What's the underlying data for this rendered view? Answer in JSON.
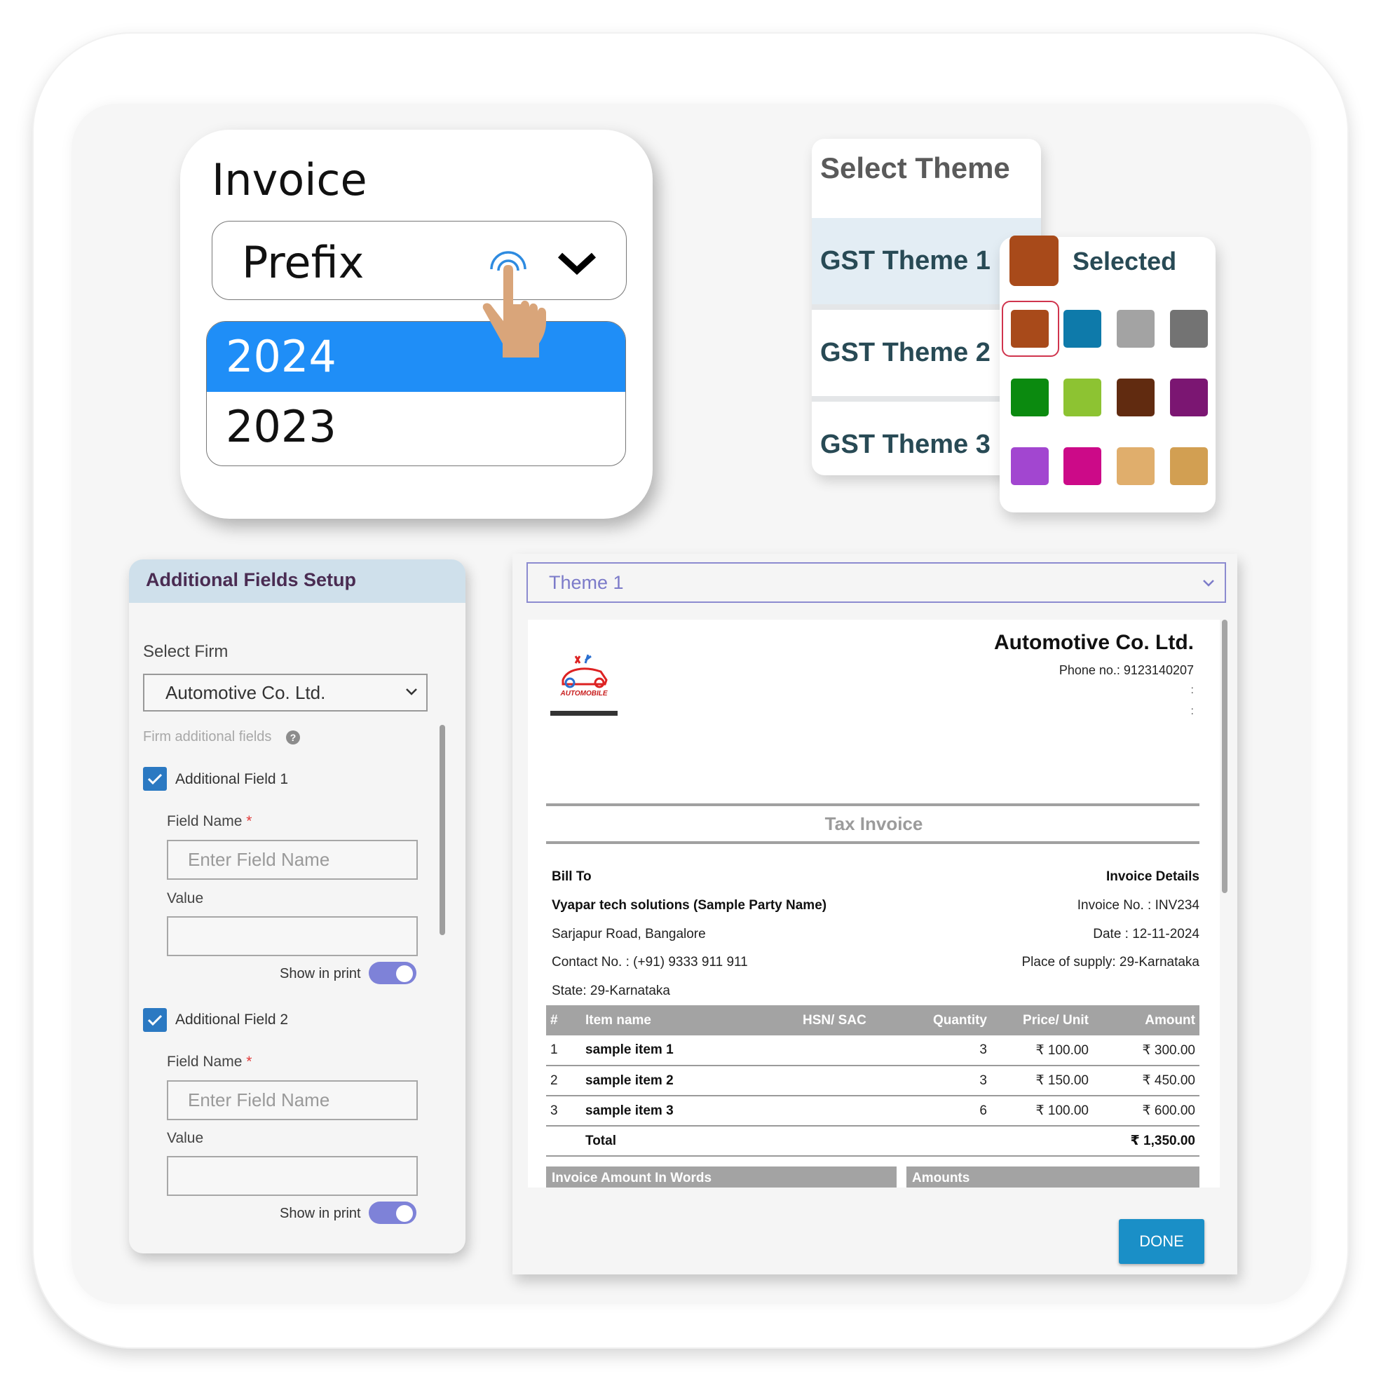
{
  "prefix_card": {
    "title": "Invoice",
    "select_label": "Prefix",
    "options": [
      {
        "label": "2024",
        "selected": true
      },
      {
        "label": "2023",
        "selected": false
      }
    ]
  },
  "theme_panel": {
    "title": "Select Theme",
    "items": [
      {
        "label": "GST Theme 1",
        "active": true
      },
      {
        "label": "GST Theme 2",
        "active": false
      },
      {
        "label": "GST Theme 3",
        "active": false
      }
    ]
  },
  "color_panel": {
    "selected_label": "Selected",
    "selected_color": "#a84a1a",
    "swatches": [
      "#a84a1a",
      "#0e7aaa",
      "#a3a3a3",
      "#737373",
      "#0b8a0f",
      "#8dc332",
      "#612b10",
      "#7b1672",
      "#a246d0",
      "#cc0a88",
      "#e0ae6c",
      "#d29f52"
    ],
    "selected_index": 0
  },
  "additional_fields": {
    "title": "Additional Fields Setup",
    "select_firm_label": "Select Firm",
    "firm_value": "Automotive Co. Ltd.",
    "hint": "Firm additional fields",
    "help_glyph": "?",
    "fields": [
      {
        "label": "Additional Field 1",
        "checked": true,
        "field_name_label": "Field Name",
        "required_mark": "*",
        "field_name_placeholder": "Enter Field Name",
        "value_label": "Value",
        "value": "",
        "show_in_print_label": "Show in print",
        "show_in_print": true
      },
      {
        "label": "Additional Field 2",
        "checked": true,
        "field_name_label": "Field Name",
        "required_mark": "*",
        "field_name_placeholder": "Enter Field Name",
        "value_label": "Value",
        "value": "",
        "show_in_print_label": "Show in print",
        "show_in_print": true
      }
    ]
  },
  "preview": {
    "theme_select_value": "Theme 1",
    "company_name": "Automotive Co. Ltd.",
    "logo_text": "AUTOMOBILE",
    "phone": "Phone no.: 9123140207",
    "placeholder_lines": [
      ":",
      ":"
    ],
    "doc_title": "Tax Invoice",
    "bill_to": {
      "heading": "Bill To",
      "party_name": "Vyapar tech solutions (Sample Party Name)",
      "address": "Sarjapur Road, Bangalore",
      "contact": "Contact No. : (+91) 9333 911 911",
      "state": "State: 29-Karnataka"
    },
    "invoice_details": {
      "heading": "Invoice Details",
      "invoice_no": "Invoice No. : INV234",
      "date": "Date : 12-11-2024",
      "place_of_supply": "Place of supply: 29-Karnataka"
    },
    "table": {
      "headers": [
        "#",
        "Item name",
        "HSN/ SAC",
        "Quantity",
        "Price/ Unit",
        "Amount"
      ],
      "rows": [
        [
          "1",
          "sample item 1",
          "",
          "3",
          "₹ 100.00",
          "₹ 300.00"
        ],
        [
          "2",
          "sample item 2",
          "",
          "3",
          "₹ 150.00",
          "₹ 450.00"
        ],
        [
          "3",
          "sample item 3",
          "",
          "6",
          "₹ 100.00",
          "₹ 600.00"
        ]
      ],
      "total_label": "Total",
      "total_value": "₹ 1,350.00"
    },
    "amount_in_words_header": "Invoice Amount In Words",
    "amounts_header": "Amounts",
    "done_label": "DONE"
  }
}
